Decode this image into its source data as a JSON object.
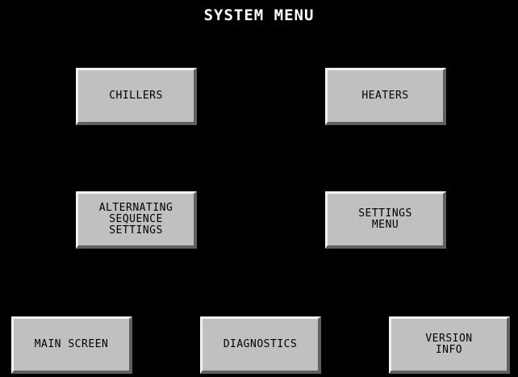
{
  "screen": {
    "title": "SYSTEM MENU"
  },
  "buttons": {
    "chillers": "CHILLERS",
    "heaters": "HEATERS",
    "alternating_sequence_settings": "ALTERNATING\nSEQUENCE\nSETTINGS",
    "settings_menu": "SETTINGS\nMENU",
    "main_screen": "MAIN SCREEN",
    "diagnostics": "DIAGNOSTICS",
    "version_info": "VERSION\nINFO"
  },
  "colors": {
    "background": "#000000",
    "title_text": "#ffffff",
    "button_face": "#c0c0c0",
    "button_text": "#000000"
  }
}
